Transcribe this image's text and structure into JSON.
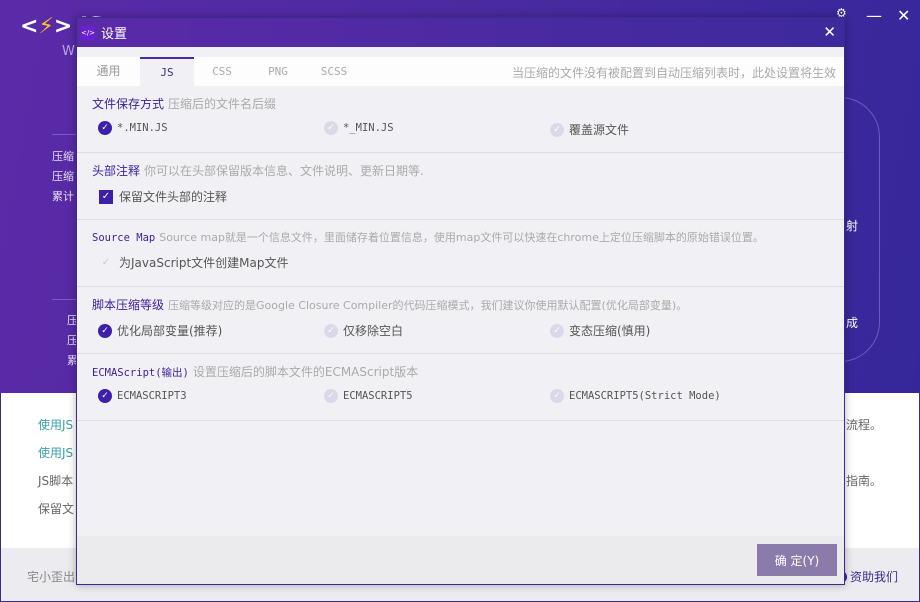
{
  "app": {
    "logo_text": "JS",
    "subtitle_partial": "W",
    "labels": [
      "压缩",
      "压缩",
      "累计",
      "压",
      "压",
      "累"
    ],
    "right_labels": [
      "射",
      "成"
    ],
    "body_rows": [
      "使用JS",
      "使用JS",
      "JS脚本",
      "保留文"
    ],
    "body_rows_right": [
      "流程。",
      "指南。"
    ],
    "footer_left": "宅小歪出",
    "footer_right": "资助我们",
    "controls": [
      "settings-icon",
      "minimize-icon",
      "close-icon"
    ]
  },
  "dialog": {
    "title": "设置",
    "tabs": [
      "通用",
      "JS",
      "CSS",
      "PNG",
      "SCSS"
    ],
    "active_tab": "JS",
    "hint": "当压缩的文件没有被配置到自动压缩列表时，此处设置将生效",
    "sections": [
      {
        "title": "文件保存方式",
        "desc": "压缩后的文件名后缀",
        "type": "radio",
        "options": [
          {
            "label": "*.MIN.JS",
            "selected": true
          },
          {
            "label": "*_MIN.JS",
            "selected": false
          },
          {
            "label": "覆盖源文件",
            "selected": false
          }
        ]
      },
      {
        "title": "头部注释",
        "desc": "你可以在头部保留版本信息、文件说明、更新日期等.",
        "type": "checkbox",
        "options": [
          {
            "label": "保留文件头部的注释",
            "checked": true
          }
        ]
      },
      {
        "title": "Source Map",
        "desc": "Source map就是一个信息文件，里面储存着位置信息，使用map文件可以快速在chrome上定位压缩脚本的原始错误位置。",
        "type": "checkbox",
        "options": [
          {
            "label": "为JavaScript文件创建Map文件",
            "checked": false
          }
        ]
      },
      {
        "title": "脚本压缩等级",
        "desc": "压缩等级对应的是Google Closure Compiler的代码压缩模式，我们建议你使用默认配置(优化局部变量)。",
        "type": "radio",
        "options": [
          {
            "label": "优化局部变量(推荐)",
            "selected": true
          },
          {
            "label": "仅移除空白",
            "selected": false
          },
          {
            "label": "变态压缩(慎用)",
            "selected": false
          }
        ]
      },
      {
        "title": "ECMAScript(输出)",
        "desc": "设置压缩后的脚本文件的ECMAScript版本",
        "type": "radio",
        "options": [
          {
            "label": "ECMASCRIPT3",
            "selected": true
          },
          {
            "label": "ECMASCRIPT5",
            "selected": false
          },
          {
            "label": "ECMASCRIPT5(Strict Mode)",
            "selected": false
          }
        ]
      }
    ],
    "ok_label": "确 定(Y)"
  },
  "colors": {
    "accent": "#3e1fa8",
    "header": "#4a2aa0",
    "ok_button": "#8b7bab"
  }
}
